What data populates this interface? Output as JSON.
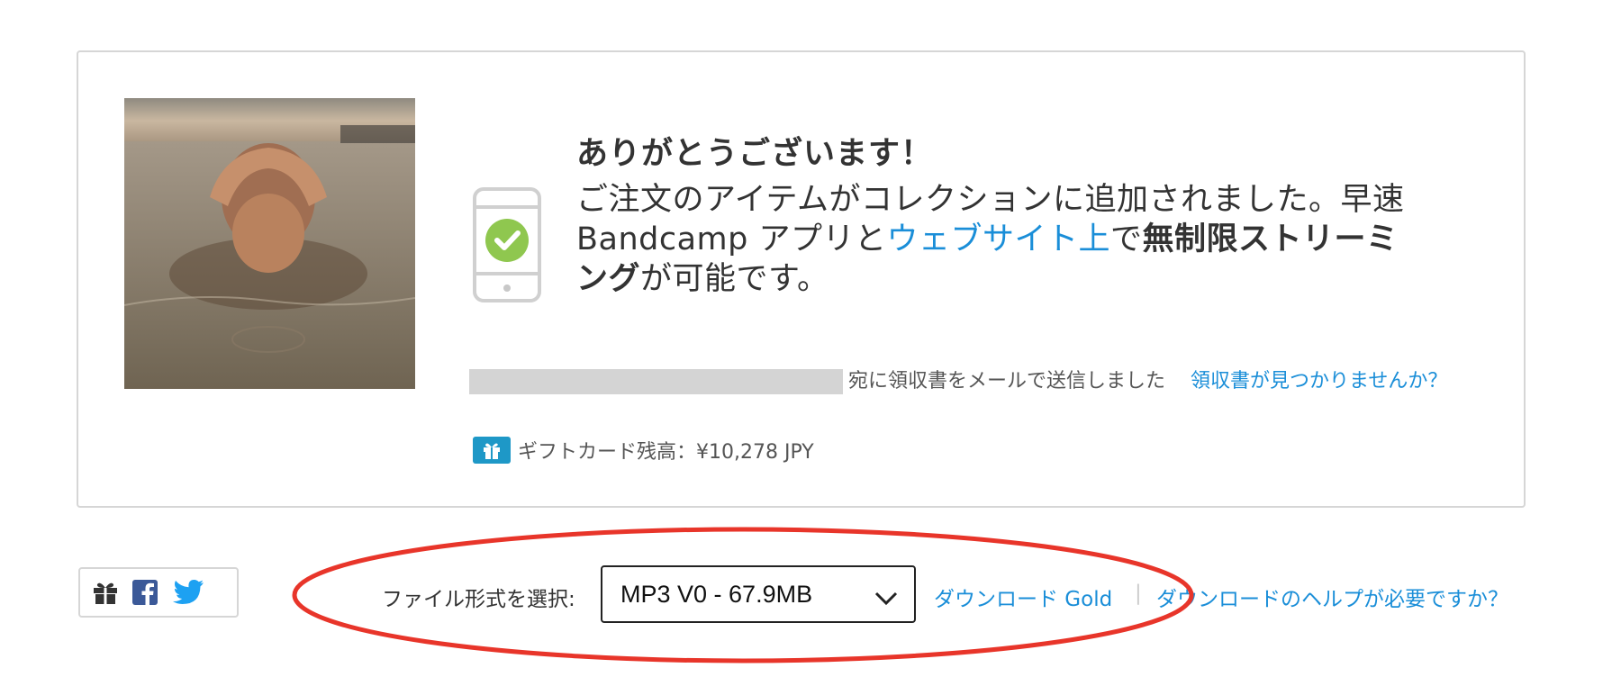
{
  "confirmation": {
    "title": "ありがとうございます！",
    "body_part1": "ご注文のアイテムがコレクションに追加されました。早速 Bandcamp アプリと",
    "body_link": "ウェブサイト上",
    "body_part2": "で",
    "body_bold1": "無制限ストリーミング",
    "body_part3": "が可能です。",
    "receipt_text": "宛に領収書をメールで送信しました",
    "receipt_missing_link": "領収書が見つかりませんか？",
    "gift_balance": "ギフトカード残高：¥10,278 JPY"
  },
  "download_bar": {
    "format_label": "ファイル形式を選択:",
    "selected_format": "MP3 V0 - 67.9MB",
    "download_gold_link": "ダウンロード Gold",
    "separator": "|",
    "help_link": "ダウンロードのヘルプが必要ですか？"
  },
  "share": {
    "icons": [
      "gift-icon",
      "facebook-icon",
      "twitter-icon"
    ]
  },
  "colors": {
    "link": "#1a8ed8",
    "check_green": "#8fc74f",
    "gift_badge": "#1e98c7",
    "annotation_red": "#e8352a"
  }
}
